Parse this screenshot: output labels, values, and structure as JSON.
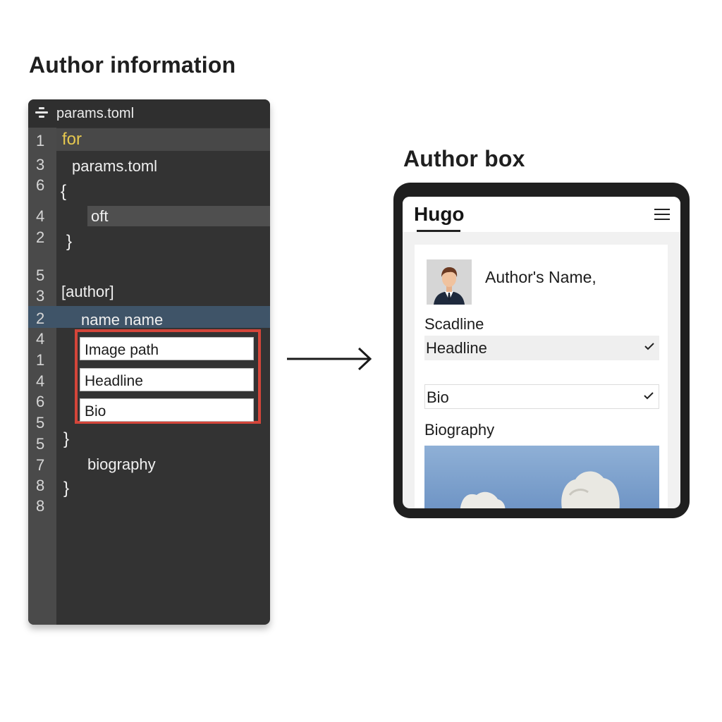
{
  "headings": {
    "left": "Author information",
    "right": "Author box"
  },
  "editor": {
    "file_name": "params.toml",
    "line_numbers": [
      "1",
      "3",
      "6",
      "4",
      "2",
      "5",
      "3",
      "2",
      "4",
      "1",
      "4",
      "6",
      "5",
      "5",
      "7",
      "8",
      "8"
    ],
    "lines": {
      "for": "for",
      "params": "params.toml",
      "open_brace_1": "{",
      "oft": "oft",
      "close_brace_1": "}",
      "author_section": "[author]",
      "name": "name name",
      "close_brace_2": "}",
      "biography": "biography",
      "close_brace_3": "}"
    },
    "fields": [
      "Image path",
      "Headline",
      "Bio"
    ],
    "colors": {
      "keyword": "#e6c84f",
      "highlight": "#d4453a",
      "selected_line": "#3f5468"
    }
  },
  "preview": {
    "brand": "Hugo",
    "author_name": "Author's Name,",
    "scadline_label": "Scadline",
    "headline_value": "Headline",
    "bio_value": "Bio",
    "biography_label": "Biography"
  }
}
